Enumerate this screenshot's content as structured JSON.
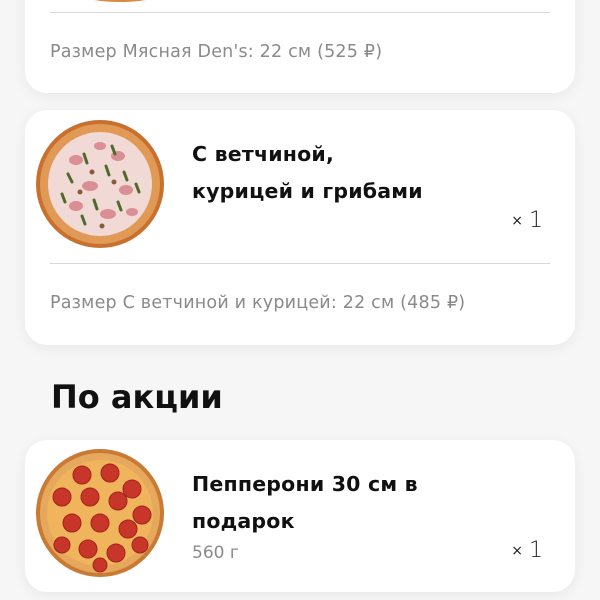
{
  "cart_items": [
    {
      "name": "",
      "size_line": "Размер Мясная Den's: 22 см (525 ₽)"
    },
    {
      "name": "С ветчиной,\nкурицей и грибами",
      "qty_prefix": "×",
      "qty_value": "1",
      "size_line": "Размер С ветчиной и курицей: 22 см (485 ₽)",
      "image_icon": "pizza-ham-chicken-mushroom-icon"
    }
  ],
  "promo_section": {
    "title": "По акции",
    "items": [
      {
        "name": "Пепперони 30 см в\nподарок",
        "weight": "560 г",
        "qty_prefix": "×",
        "qty_value": "1",
        "image_icon": "pizza-pepperoni-icon"
      }
    ]
  },
  "colors": {
    "background": "#f6f6f6",
    "card": "#ffffff",
    "muted_text": "#8a8a8a",
    "divider": "#d8d8d8"
  }
}
